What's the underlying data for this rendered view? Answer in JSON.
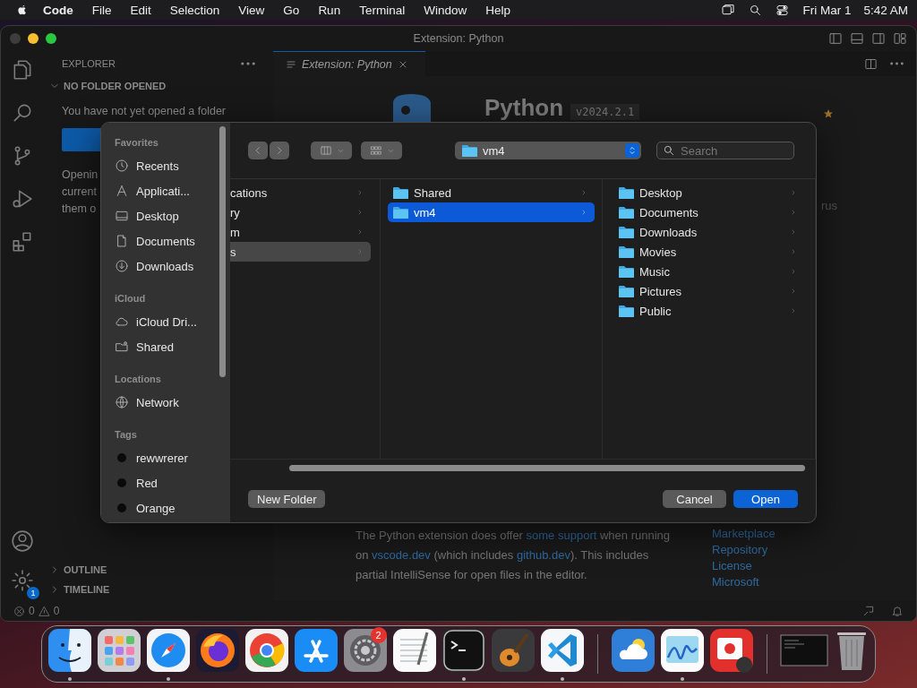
{
  "menu_bar": {
    "app": "Code",
    "items": [
      "File",
      "Edit",
      "Selection",
      "View",
      "Go",
      "Run",
      "Terminal",
      "Window",
      "Help"
    ],
    "date": "Fri Mar 1",
    "time": "5:42 AM"
  },
  "window": {
    "title": "Extension: Python"
  },
  "activity_bar": {
    "settings_badge": "1"
  },
  "sidebar": {
    "header": "EXPLORER",
    "section": "NO FOLDER OPENED",
    "message": "You have not yet opened a folder",
    "text_lines": [
      "Openin",
      "current",
      "them o"
    ],
    "panels": [
      "OUTLINE",
      "TIMELINE"
    ]
  },
  "tab": {
    "label": "Extension: Python"
  },
  "extension": {
    "name": "Python",
    "version": "v2024.2.1",
    "fragment": "rus",
    "description": [
      {
        "text": "The Python extension does offer ",
        "link": false
      },
      {
        "text": "some support",
        "link": true
      },
      {
        "text": " when running on ",
        "link": false
      },
      {
        "text": "vscode.dev",
        "link": true
      },
      {
        "text": " (which includes ",
        "link": false
      },
      {
        "text": "github.dev",
        "link": true
      },
      {
        "text": "). This includes partial IntelliSense for open files in the editor.",
        "link": false
      }
    ],
    "resources": [
      "Marketplace",
      "Repository",
      "License",
      "Microsoft"
    ]
  },
  "status_bar": {
    "errors": "0",
    "warnings": "0"
  },
  "dialog": {
    "sidebar": [
      {
        "title": "Favorites",
        "items": [
          {
            "kind": "recents",
            "label": "Recents"
          },
          {
            "kind": "apps",
            "label": "Applicati..."
          },
          {
            "kind": "desktop",
            "label": "Desktop"
          },
          {
            "kind": "document",
            "label": "Documents"
          },
          {
            "kind": "download",
            "label": "Downloads"
          }
        ]
      },
      {
        "title": "iCloud",
        "items": [
          {
            "kind": "cloud",
            "label": "iCloud Dri..."
          },
          {
            "kind": "shared",
            "label": "Shared"
          }
        ]
      },
      {
        "title": "Locations",
        "items": [
          {
            "kind": "network",
            "label": "Network"
          }
        ]
      },
      {
        "title": "Tags",
        "items": [
          {
            "kind": "tag",
            "label": "rewwrerer"
          },
          {
            "kind": "tag",
            "label": "Red"
          },
          {
            "kind": "tag",
            "label": "Orange"
          }
        ]
      }
    ],
    "path": "vm4",
    "search": {
      "placeholder": "Search"
    },
    "columns": [
      {
        "items": [
          {
            "label": "cations",
            "folder": false,
            "selected": false
          },
          {
            "label": "ry",
            "folder": false,
            "selected": false
          },
          {
            "label": "m",
            "folder": false,
            "selected": false
          },
          {
            "label": "s",
            "folder": false,
            "selected": true,
            "focused": false
          }
        ]
      },
      {
        "items": [
          {
            "label": "Shared",
            "folder": true,
            "selected": false
          },
          {
            "label": "vm4",
            "folder": true,
            "selected": true,
            "focused": true
          }
        ]
      },
      {
        "items": [
          {
            "label": "Desktop",
            "folder": true,
            "selected": false
          },
          {
            "label": "Documents",
            "folder": true,
            "selected": false
          },
          {
            "label": "Downloads",
            "folder": true,
            "selected": false
          },
          {
            "label": "Movies",
            "folder": true,
            "selected": false
          },
          {
            "label": "Music",
            "folder": true,
            "selected": false
          },
          {
            "label": "Pictures",
            "folder": true,
            "selected": false
          },
          {
            "label": "Public",
            "folder": true,
            "selected": false
          }
        ]
      }
    ],
    "buttons": {
      "new_folder": "New Folder",
      "cancel": "Cancel",
      "open": "Open"
    }
  },
  "dock": [
    {
      "kind": "finder",
      "running": true
    },
    {
      "kind": "launchpad",
      "running": false
    },
    {
      "kind": "safari",
      "running": true
    },
    {
      "kind": "firefox",
      "running": false
    },
    {
      "kind": "chrome",
      "running": false
    },
    {
      "kind": "appstore",
      "running": false
    },
    {
      "kind": "settings",
      "running": false,
      "badge": "2"
    },
    {
      "kind": "textedit",
      "running": false
    },
    {
      "kind": "terminal",
      "running": true
    },
    {
      "kind": "guitar",
      "running": false
    },
    {
      "kind": "vscode",
      "running": true
    },
    {
      "kind": "separator"
    },
    {
      "kind": "weather",
      "running": false
    },
    {
      "kind": "freeform",
      "running": true
    },
    {
      "kind": "photos",
      "running": false
    },
    {
      "kind": "separator"
    },
    {
      "kind": "window",
      "running": false
    },
    {
      "kind": "trash",
      "running": false
    }
  ]
}
